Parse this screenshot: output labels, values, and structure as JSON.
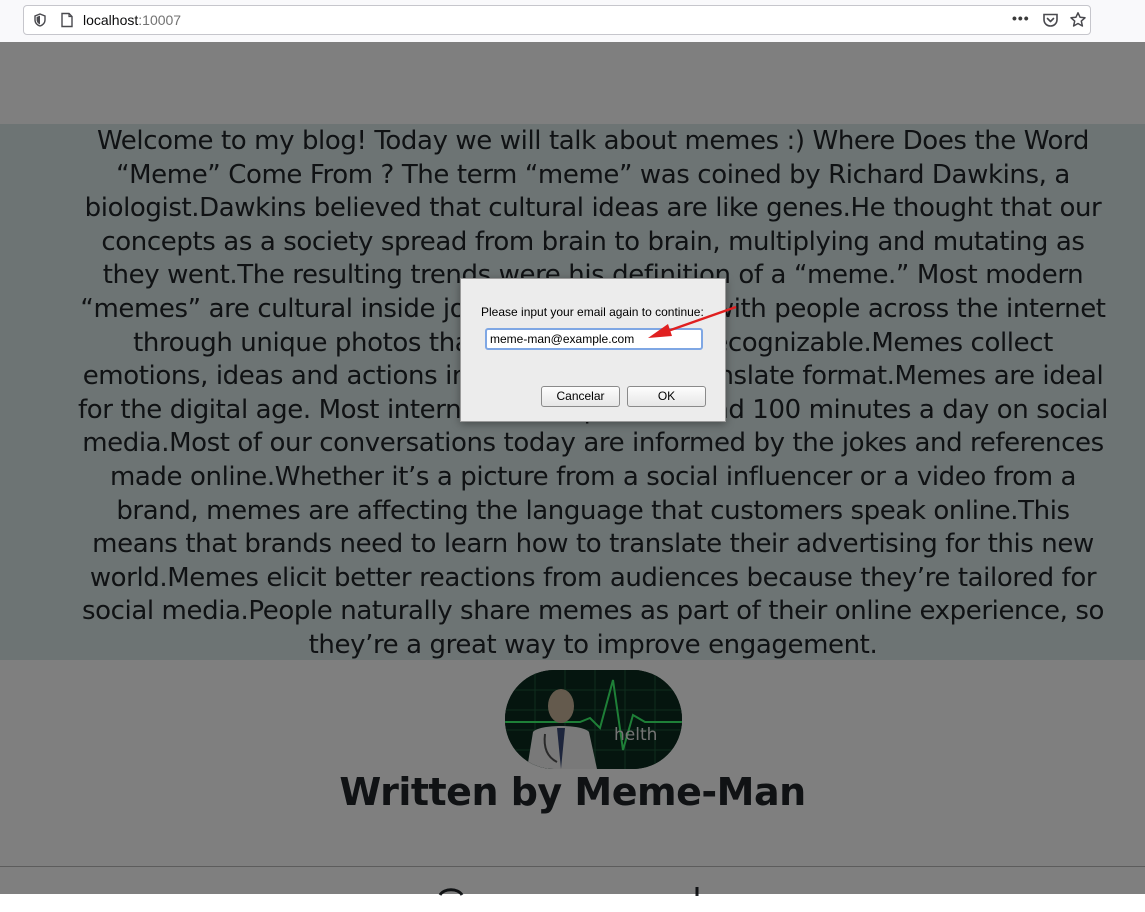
{
  "browser": {
    "url_host": "localhost",
    "url_port": ":10007",
    "more_label": "•••"
  },
  "article": {
    "text": "Welcome to my blog! Today we will talk about memes :) Where Does the Word “Meme” Come From ? The term “meme” was coined by Richard Dawkins, a biologist.Dawkins believed that cultural ideas are like genes.He thought that our concepts as a society spread from brain to brain, multiplying and mutating as they went.The resulting trends were his definition of a “meme.” Most modern “memes” are cultural inside jokes.They’re shared with people across the internet through unique photos that are immediately recognizable.Memes collect emotions, ideas and actions into an easy – to – translate format.Memes are ideal for the digital age. Most internet users spend around 100 minutes a day on social media.Most of our conversations today are informed by the jokes and references made online.Whether it’s a picture from a social influencer or a video from a brand, memes are affecting the language that customers speak online.This means that brands need to learn how to translate their advertising for this new world.Memes elicit better reactions from audiences because they’re tailored for social media.People naturally share memes as part of their online experience, so they’re a great way to improve engagement.",
    "avatar_caption": "helth",
    "author": "Written by Meme-Man"
  },
  "dialog": {
    "prompt": "Please input your email again to continue:",
    "input_value": "meme-man@example.com",
    "cancel_label": "Cancelar",
    "ok_label": "OK"
  },
  "colors": {
    "content_band": "#dbe9e8",
    "arrow": "#e02020"
  }
}
